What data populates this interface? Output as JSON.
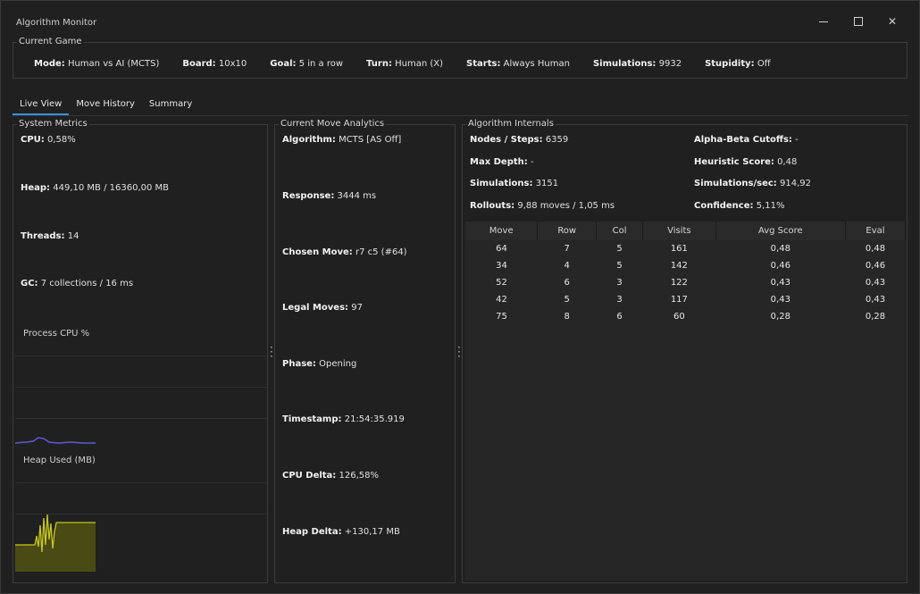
{
  "window": {
    "title": "Algorithm Monitor"
  },
  "current_game": {
    "group_label": "Current Game",
    "items": [
      {
        "key": "Mode:",
        "value": "Human vs AI (MCTS)"
      },
      {
        "key": "Board:",
        "value": "10x10"
      },
      {
        "key": "Goal:",
        "value": "5 in a row"
      },
      {
        "key": "Turn:",
        "value": "Human (X)"
      },
      {
        "key": "Starts:",
        "value": "Always Human"
      },
      {
        "key": "Simulations:",
        "value": "9932"
      },
      {
        "key": "Stupidity:",
        "value": "Off"
      }
    ]
  },
  "tabs": [
    {
      "label": "Live View"
    },
    {
      "label": "Move History"
    },
    {
      "label": "Summary"
    }
  ],
  "system_metrics": {
    "group_label": "System Metrics",
    "cpu": {
      "key": "CPU:",
      "value": "0,58%"
    },
    "heap": {
      "key": "Heap:",
      "value": "449,10 MB / 16360,00 MB"
    },
    "threads": {
      "key": "Threads:",
      "value": "14"
    },
    "gc": {
      "key": "GC:",
      "value": "7 collections / 16 ms"
    },
    "process_cpu_label": "Process CPU %",
    "heap_used_label": "Heap Used (MB)",
    "cpu_line_color": "#5b5bd6",
    "heap_line_color": "#c8c81e",
    "heap_fill_color": "#4a4a14"
  },
  "move_analytics": {
    "group_label": "Current Move Analytics",
    "items": [
      {
        "key": "Algorithm:",
        "value": "MCTS [AS Off]"
      },
      {
        "key": "Response:",
        "value": "3444 ms"
      },
      {
        "key": "Chosen Move:",
        "value": "r7 c5 (#64)"
      },
      {
        "key": "Legal Moves:",
        "value": "97"
      },
      {
        "key": "Phase:",
        "value": "Opening"
      },
      {
        "key": "Timestamp:",
        "value": "21:54:35.919"
      },
      {
        "key": "CPU Delta:",
        "value": "126,58%"
      },
      {
        "key": "Heap Delta:",
        "value": "+130,17 MB"
      }
    ]
  },
  "internals": {
    "group_label": "Algorithm Internals",
    "left": [
      {
        "key": "Nodes / Steps:",
        "value": "6359"
      },
      {
        "key": "Max Depth:",
        "value": "-"
      },
      {
        "key": "Simulations:",
        "value": "3151"
      },
      {
        "key": "Rollouts:",
        "value": "9,88 moves / 1,05 ms"
      }
    ],
    "right": [
      {
        "key": "Alpha-Beta Cutoffs:",
        "value": "-"
      },
      {
        "key": "Heuristic Score:",
        "value": "0,48"
      },
      {
        "key": "Simulations/sec:",
        "value": "914,92"
      },
      {
        "key": "Confidence:",
        "value": "5,11%"
      }
    ],
    "table": {
      "headers": [
        "Move",
        "Row",
        "Col",
        "Visits",
        "Avg Score",
        "Eval"
      ],
      "rows": [
        [
          "64",
          "7",
          "5",
          "161",
          "0,48",
          "0,48"
        ],
        [
          "34",
          "4",
          "5",
          "142",
          "0,46",
          "0,46"
        ],
        [
          "52",
          "6",
          "3",
          "122",
          "0,43",
          "0,43"
        ],
        [
          "42",
          "5",
          "3",
          "117",
          "0,43",
          "0,43"
        ],
        [
          "75",
          "8",
          "6",
          "60",
          "0,28",
          "0,28"
        ]
      ]
    }
  }
}
